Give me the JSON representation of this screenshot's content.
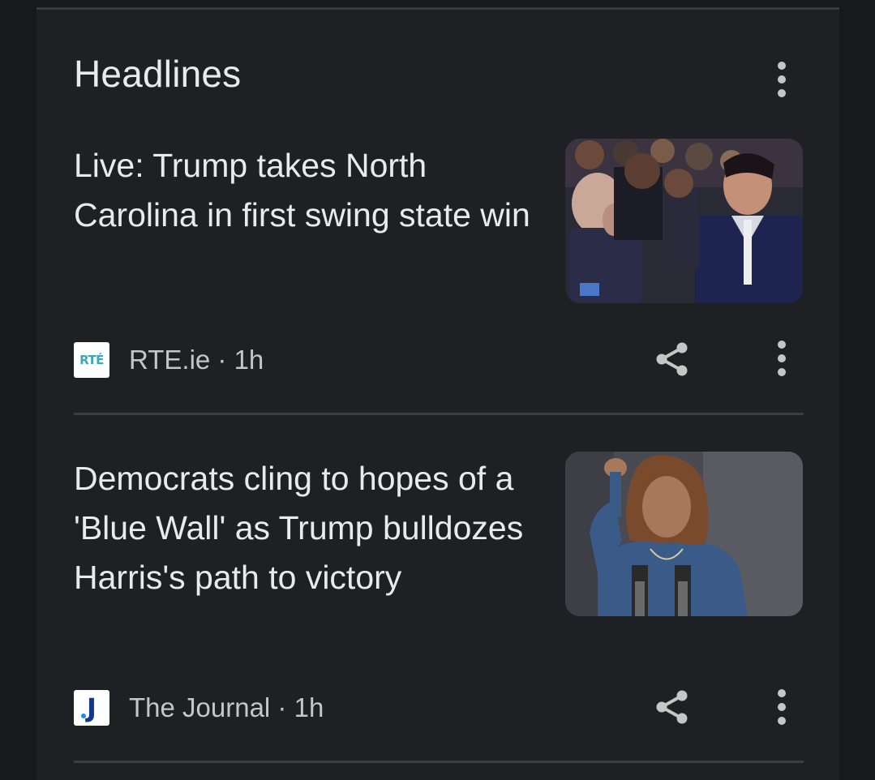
{
  "header": {
    "title": "Headlines"
  },
  "articles": [
    {
      "headline": "Live: Trump takes North Carolina in first swing state win",
      "source": "RTE.ie",
      "favicon_text": "RTÉ",
      "age": "1h",
      "source_line": "RTE.ie · 1h"
    },
    {
      "headline": "Democrats cling to hopes of a 'Blue Wall' as Trump bulldozes Harris's path to victory",
      "source": "The Journal",
      "favicon_text": "J",
      "age": "1h",
      "source_line": "The Journal · 1h"
    }
  ],
  "icons": {
    "more": "more-vert-icon",
    "share": "share-icon"
  },
  "colors": {
    "background": "#18191b",
    "card": "#1f2023",
    "text_primary": "#e8eaed",
    "text_secondary": "#c4c7c5",
    "divider": "#3c3d40"
  }
}
